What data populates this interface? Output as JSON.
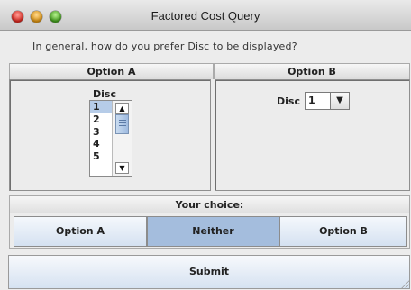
{
  "window": {
    "title": "Factored Cost Query"
  },
  "question": "In general, how do you prefer Disc to be displayed?",
  "options": {
    "a": {
      "header": "Option A",
      "list_label": "Disc",
      "items": [
        "1",
        "2",
        "3",
        "4",
        "5"
      ],
      "selected": "1"
    },
    "b": {
      "header": "Option B",
      "combo_label": "Disc",
      "combo_value": "1"
    }
  },
  "choice": {
    "label": "Your choice:",
    "buttons": [
      "Option A",
      "Neither",
      "Option B"
    ],
    "selected": "Neither"
  },
  "submit_label": "Submit",
  "icons": {
    "close": "close-button-icon",
    "minimize": "minimize-button-icon",
    "zoom": "zoom-button-icon",
    "scroll_up": "arrow-up-icon",
    "scroll_down": "arrow-down-icon",
    "combo": "chevron-down-icon",
    "resize": "resize-grip-icon"
  },
  "colors": {
    "selected_choice": "#a4bddd",
    "selected_list_item": "#b6cce8"
  }
}
